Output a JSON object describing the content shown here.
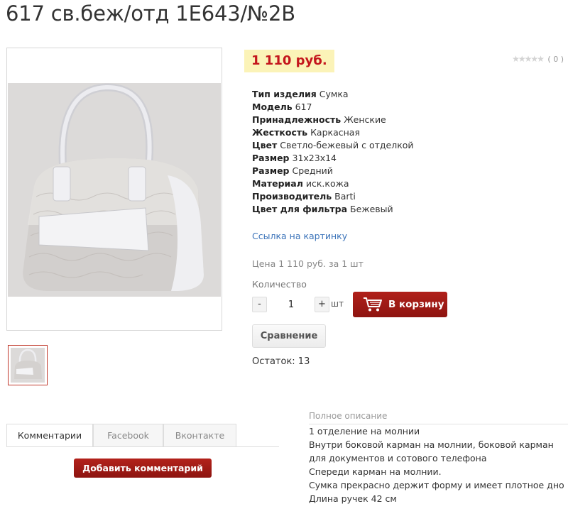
{
  "product": {
    "title": "617 св.беж/отд 1Е643/№2В",
    "price": "1 110 руб.",
    "rating": {
      "stars": "★★★★★",
      "count": "( 0 )"
    },
    "properties": [
      {
        "key": "Тип изделия",
        "value": "Сумка"
      },
      {
        "key": "Модель",
        "value": "617"
      },
      {
        "key": "Принадлежность",
        "value": "Женские"
      },
      {
        "key": "Жесткость",
        "value": "Каркасная"
      },
      {
        "key": "Цвет",
        "value": "Светло-бежевый с отделкой"
      },
      {
        "key": "Размер",
        "value": "31x23x14"
      },
      {
        "key": "Размер",
        "value": "Средний"
      },
      {
        "key": "Материал",
        "value": "иск.кожа"
      },
      {
        "key": "Производитель",
        "value": "Barti"
      },
      {
        "key": "Цвет для фильтра",
        "value": "Бежевый"
      }
    ],
    "image_link": "Ссылка на картинку",
    "price_per_unit": "Цена 1 110 руб. за 1 шт",
    "quantity_label": "Количество",
    "quantity_minus": "-",
    "quantity_value": "1",
    "quantity_plus": "+",
    "unit": "шт",
    "add_to_cart": "В корзину",
    "compare": "Сравнение",
    "stock": "Остаток: 13"
  },
  "tabs": [
    {
      "label": "Комментарии",
      "active": true
    },
    {
      "label": "Facebook",
      "active": false
    },
    {
      "label": "Вконтакте",
      "active": false
    }
  ],
  "add_comment": "Добавить комментарий",
  "description": {
    "title": "Полное описание",
    "lines": [
      "1 отделение на молнии",
      "Внутри боковой карман на молнии, боковой карман для документов и сотового телефона",
      "Спереди карман на молнии.",
      "Сумка прекрасно держит форму и имеет плотное дно",
      "Длина ручек 42 см"
    ]
  },
  "colors": {
    "price_bg": "#fbf3b8",
    "price_text": "#c4161c",
    "button_red": "#9b1912",
    "link_blue": "#3b73b9"
  }
}
